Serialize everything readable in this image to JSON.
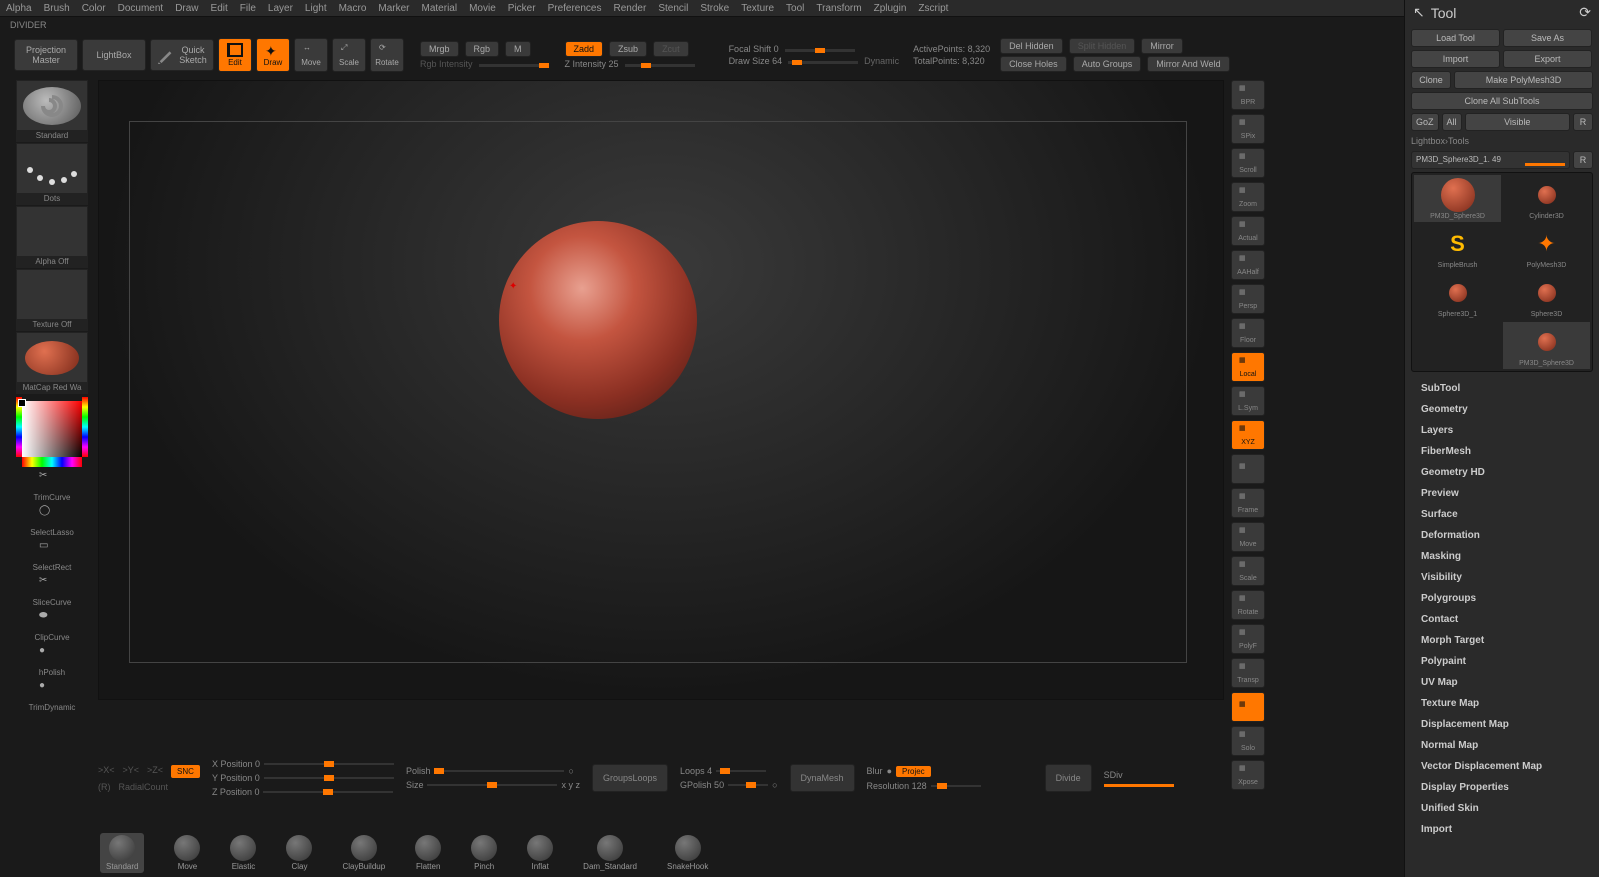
{
  "menu": [
    "Alpha",
    "Brush",
    "Color",
    "Document",
    "Draw",
    "Edit",
    "File",
    "Layer",
    "Light",
    "Macro",
    "Marker",
    "Material",
    "Movie",
    "Picker",
    "Preferences",
    "Render",
    "Stencil",
    "Stroke",
    "Texture",
    "Tool",
    "Transform",
    "Zplugin",
    "Zscript"
  ],
  "divider": "DIVIDER",
  "toolbar": {
    "projection": "Projection\nMaster",
    "lightbox": "LightBox",
    "quicksketch": "Quick\nSketch",
    "edit": "Edit",
    "draw": "Draw",
    "move": "Move",
    "scale": "Scale",
    "rotate": "Rotate",
    "mrgb": "Mrgb",
    "rgb": "Rgb",
    "m": "M",
    "rgb_intensity": "Rgb Intensity",
    "zadd": "Zadd",
    "zsub": "Zsub",
    "zcut": "Zcut",
    "z_intensity": "Z Intensity 25",
    "focal_shift": "Focal Shift 0",
    "draw_size": "Draw Size 64",
    "dynamic": "Dynamic",
    "active_points": "ActivePoints: 8,320",
    "total_points": "TotalPoints: 8,320",
    "del_hidden": "Del Hidden",
    "split_hidden": "Split Hidden",
    "close_holes": "Close Holes",
    "mirror": "Mirror",
    "auto_groups": "Auto Groups",
    "mirror_weld": "Mirror And Weld"
  },
  "left": {
    "brush": "Standard",
    "stroke": "Dots",
    "alpha": "Alpha Off",
    "texture": "Texture Off",
    "material": "MatCap Red Wa",
    "tools": [
      "TrimCurve",
      "SelectLasso",
      "SelectRect",
      "SliceCurve",
      "ClipCurve",
      "hPolish",
      "TrimDynamic"
    ]
  },
  "right_strip": [
    {
      "l": "BPR",
      "lit": false
    },
    {
      "l": "SPix",
      "lit": false
    },
    {
      "l": "Scroll",
      "lit": false
    },
    {
      "l": "Zoom",
      "lit": false
    },
    {
      "l": "Actual",
      "lit": false
    },
    {
      "l": "AAHalf",
      "lit": false
    },
    {
      "l": "Persp",
      "lit": false
    },
    {
      "l": "Floor",
      "lit": false
    },
    {
      "l": "Local",
      "lit": true
    },
    {
      "l": "L.Sym",
      "lit": false
    },
    {
      "l": "XYZ",
      "lit": true
    },
    {
      "l": "",
      "lit": false
    },
    {
      "l": "Frame",
      "lit": false
    },
    {
      "l": "Move",
      "lit": false
    },
    {
      "l": "Scale",
      "lit": false
    },
    {
      "l": "Rotate",
      "lit": false
    },
    {
      "l": "PolyF",
      "lit": false
    },
    {
      "l": "Transp",
      "lit": false
    },
    {
      "l": "",
      "lit": true
    },
    {
      "l": "Solo",
      "lit": false
    },
    {
      "l": "Xpose",
      "lit": false
    }
  ],
  "bottom": {
    "axis_x": ">X<",
    "axis_y": ">Y<",
    "axis_z": ">Z<",
    "rec": "SNC",
    "radial_r": "(R)",
    "radial": "RadialCount",
    "xpos": "X Position 0",
    "ypos": "Y Position 0",
    "zpos": "Z Position 0",
    "polish": "Polish",
    "size": "Size",
    "xyz": "x y z",
    "groups_loops": "GroupsLoops",
    "loops": "Loops 4",
    "gpolish": "GPolish 50",
    "dynamesh": "DynaMesh",
    "blur": "Blur",
    "project": "Projec",
    "resolution": "Resolution 128",
    "divide": "Divide",
    "sdiv": "SDiv"
  },
  "brush_shelf": [
    "Standard",
    "Move",
    "Elastic",
    "Clay",
    "ClayBuildup",
    "Flatten",
    "Pinch",
    "Inflat",
    "Dam_Standard",
    "SnakeHook"
  ],
  "tool_panel": {
    "title": "Tool",
    "load": "Load Tool",
    "save": "Save As",
    "import": "Import",
    "export": "Export",
    "clone": "Clone",
    "makepm3d": "Make PolyMesh3D",
    "cloneall": "Clone All SubTools",
    "goz": "GoZ",
    "all": "All",
    "visible": "Visible",
    "r": "R",
    "crumb": "Lightbox›Tools",
    "current": "PM3D_Sphere3D_1. 49",
    "r2": "R",
    "grid": [
      "PM3D_Sphere3D",
      "Cylinder3D",
      "SimpleBrush",
      "PolyMesh3D",
      "Sphere3D_1",
      "Sphere3D",
      "",
      "PM3D_Sphere3D"
    ],
    "sections": [
      "SubTool",
      "Geometry",
      "Layers",
      "FiberMesh",
      "Geometry HD",
      "Preview",
      "Surface",
      "Deformation",
      "Masking",
      "Visibility",
      "Polygroups",
      "Contact",
      "Morph Target",
      "Polypaint",
      "UV Map",
      "Texture Map",
      "Displacement Map",
      "Normal Map",
      "Vector Displacement Map",
      "Display Properties",
      "Unified Skin",
      "Import"
    ]
  }
}
